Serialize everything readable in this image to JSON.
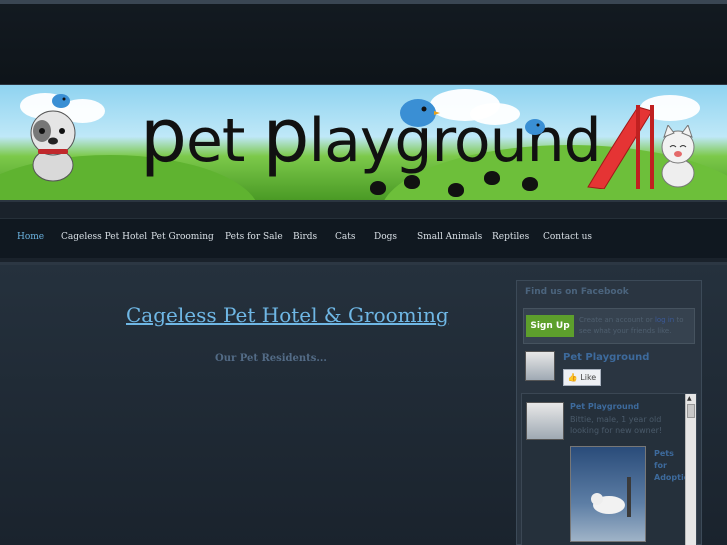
{
  "banner": {
    "title_prefix": "p",
    "title_first": "et ",
    "title_prefix2": "p",
    "title_second": "layground"
  },
  "nav": {
    "items": [
      {
        "label": "Home",
        "active": true
      },
      {
        "label": "Cageless Pet Hotel"
      },
      {
        "label": "Pet Grooming"
      },
      {
        "label": "Pets for Sale"
      },
      {
        "label": "Birds"
      },
      {
        "label": "Cats"
      },
      {
        "label": "Dogs"
      },
      {
        "label": "Small Animals"
      },
      {
        "label": "Reptiles"
      },
      {
        "label": "Contact us"
      }
    ]
  },
  "main": {
    "heading": "Cageless Pet Hotel & Grooming",
    "subheading": "Our Pet Residents..."
  },
  "facebook": {
    "title": "Find us on Facebook",
    "signup_label": "Sign Up",
    "signup_note_a": "Create an account or ",
    "signup_note_link": "log in",
    "signup_note_b": " to see what your friends like.",
    "page_name": "Pet Playground",
    "like_label": "Like",
    "feed_name": "Pet Playground",
    "feed_text": "Bittie, male, 1 year old looking for new owner!",
    "feed_side_label": "Pets for Adoption"
  },
  "colors": {
    "accent": "#6bb3e0",
    "fb_button": "#5d9f2c",
    "fb_link": "#3d6a9c"
  }
}
